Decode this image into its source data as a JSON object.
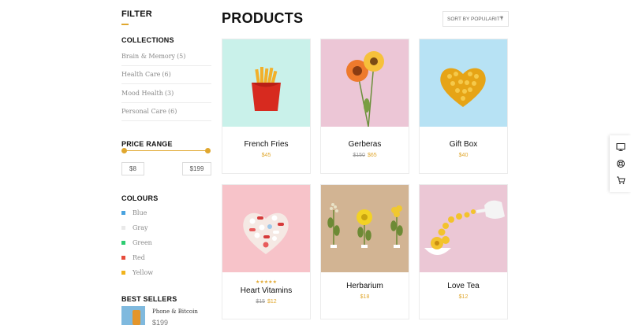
{
  "filter": {
    "title": "FILTER",
    "collections": {
      "title": "COLLECTIONS",
      "items": [
        {
          "label": "Brain & Memory",
          "count": "(5)"
        },
        {
          "label": "Health Care",
          "count": "(6)"
        },
        {
          "label": "Mood Health",
          "count": "(3)"
        },
        {
          "label": "Personal Care",
          "count": "(6)"
        }
      ]
    },
    "price_range": {
      "title": "PRICE RANGE",
      "min": "$8",
      "max": "$199"
    },
    "colours": {
      "title": "COLOURS",
      "items": [
        {
          "label": "Blue",
          "color": "#4aa3df"
        },
        {
          "label": "Gray",
          "color": "#e9e9e9"
        },
        {
          "label": "Green",
          "color": "#2ecc71"
        },
        {
          "label": "Red",
          "color": "#e74c3c"
        },
        {
          "label": "Yellow",
          "color": "#f1b31c"
        }
      ]
    },
    "best_sellers": {
      "title": "BEST SELLERS",
      "items": [
        {
          "name": "Phone & Bitcoin",
          "price": "$199"
        }
      ]
    }
  },
  "main": {
    "title": "PRODUCTS",
    "sort": {
      "selected": "SORT BY POPULARITY"
    },
    "products": [
      {
        "name": "French Fries",
        "old_price": "",
        "price": "$45",
        "rating_stars": "",
        "bg": "#c9f1ea",
        "icon": "french-fries-image"
      },
      {
        "name": "Gerberas",
        "old_price": "$150",
        "price": "$65",
        "rating_stars": "",
        "bg": "#ecc6d6",
        "icon": "gerbera-flowers-image"
      },
      {
        "name": "Gift Box",
        "old_price": "",
        "price": "$40",
        "rating_stars": "",
        "bg": "#b7e2f4",
        "icon": "gold-heart-image"
      },
      {
        "name": "Heart Vitamins",
        "old_price": "$15",
        "price": "$12",
        "rating_stars": "★★★★★",
        "bg": "#f7c3c9",
        "icon": "pill-heart-image"
      },
      {
        "name": "Herbarium",
        "old_price": "",
        "price": "$18",
        "rating_stars": "",
        "bg": "#d2b493",
        "icon": "pressed-flowers-image"
      },
      {
        "name": "Love Tea",
        "old_price": "",
        "price": "$12",
        "rating_stars": "",
        "bg": "#ebc7d5",
        "icon": "teapot-flowers-image"
      }
    ]
  },
  "float_bar": {
    "icons": [
      "monitor-icon",
      "lifebuoy-icon",
      "cart-icon"
    ]
  },
  "colors": {
    "accent": "#e0a72e"
  }
}
